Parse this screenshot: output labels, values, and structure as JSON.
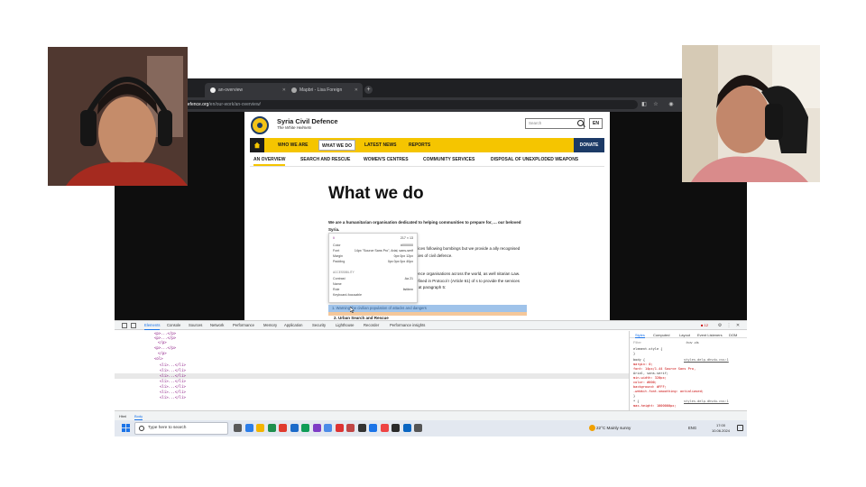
{
  "browser": {
    "tabs": [
      {
        "label": "an-overview"
      },
      {
        "label": "Mapbri - Lisa Foreign"
      }
    ],
    "url_domain": "defence.org",
    "url_path": "/en/our-work/an-overview/"
  },
  "site": {
    "title": "Syria Civil Defence",
    "subtitle": "The White Helmets",
    "search_placeholder": "Search",
    "lang": "EN",
    "nav": [
      "WHO WE ARE",
      "WHAT WE DO",
      "LATEST NEWS",
      "REPORTS"
    ],
    "donate": "DONATE",
    "subnav": [
      "AN OVERVIEW",
      "SEARCH AND RESCUE",
      "WOMEN'S CENTRES",
      "COMMUNITY SERVICES",
      "DISPOSAL OF UNEXPLODED WEAPONS"
    ],
    "heading": "What we do",
    "intro": "We are a humanitarian organisation dedicated to helping communities to prepare for, ... our beloved Syria.",
    "para2": "r services following bombings but we provide a ally recognised activities of civil defence.",
    "para3": "ll defence organisations across the world, as well nitarian Law. As defined in Protocol I (Article 61) of s to provide the services listed at paragraph 5:",
    "highlighted_item": "1. Warning the civilian population of attacks and dangers",
    "next_item": "2. Urban Search and Rescue"
  },
  "inspector_tooltip": {
    "tag": "li",
    "size": "217 × 13",
    "rows": [
      {
        "k": "Color",
        "v": "#000000"
      },
      {
        "k": "Font",
        "v": "14px \"Source Sans Pro\", Arial, sans-serif"
      },
      {
        "k": "Margin",
        "v": "0px 0px 12px"
      },
      {
        "k": "Padding",
        "v": "0px 0px 0px 40px"
      }
    ],
    "accessibility_label": "ACCESSIBILITY",
    "acc_rows": [
      {
        "k": "Contrast",
        "v": "Aa 21"
      },
      {
        "k": "Name",
        "v": ""
      },
      {
        "k": "Role",
        "v": "listitem"
      },
      {
        "k": "Keyboard-focusable",
        "v": ""
      }
    ]
  },
  "devtools": {
    "tabs": [
      "Elements",
      "Console",
      "Sources",
      "Network",
      "Performance",
      "Memory",
      "Application",
      "Security",
      "Lighthouse",
      "Recorder",
      "Performance insights"
    ],
    "issues_badge": "12",
    "dom_lines": [
      "<p>...</p>",
      "<p>...</p>",
      "</p>",
      "<p>...</p>",
      "</p>",
      "<ol>",
      "<li>...</li>",
      "<li>...</li>",
      "<li>...</li>",
      "<li>...</li>",
      "<li>...</li>",
      "<li>...</li>",
      "<li>...</li>"
    ],
    "styles_tabs": [
      "Styles",
      "Computed",
      "Layout",
      "Event Listeners",
      "DOM"
    ],
    "filter_placeholder": "Filter",
    "hov_cls": ":hov .cls",
    "css_lines": [
      {
        "text": "element.style {",
        "src": ""
      },
      {
        "text": "}",
        "src": ""
      },
      {
        "text": "body {",
        "src": "styles.delp.dhvdu.css:1"
      },
      {
        "text": "  margin: 0;",
        "src": ""
      },
      {
        "text": "  font: 14px/1.44 Source Sans Pro,",
        "src": ""
      },
      {
        "text": "    Arial, sans-serif;",
        "src": ""
      },
      {
        "text": "  min-width: 320px;",
        "src": ""
      },
      {
        "text": "  color: #000;",
        "src": ""
      },
      {
        "text": "  background: #FFF;",
        "src": ""
      },
      {
        "text": "  -webkit-font-smoothing: antialiased;",
        "src": ""
      },
      {
        "text": "}",
        "src": ""
      },
      {
        "text": "* {",
        "src": "styles.delp.dhvdu.css:1"
      },
      {
        "text": "  max-height: 1000000px;",
        "src": ""
      }
    ],
    "drawer_tabs": [
      "Html",
      "Body"
    ]
  },
  "taskbar": {
    "search_placeholder": "Type here to search",
    "weather": "22°C  Mainly sunny",
    "lang": "ENG",
    "time": "17:00",
    "date": "10.06.2024",
    "app_colors": [
      "#5a5a5a",
      "#2b7de9",
      "#f3b400",
      "#1e8f4e",
      "#e03b2f",
      "#1b6ac9",
      "#0f9d58",
      "#7e3cc6",
      "#4b8be8",
      "#d33",
      "#c04646",
      "#333",
      "#1a73e8",
      "#e44",
      "#2a2a2a",
      "#0a66c2",
      "#555"
    ]
  }
}
